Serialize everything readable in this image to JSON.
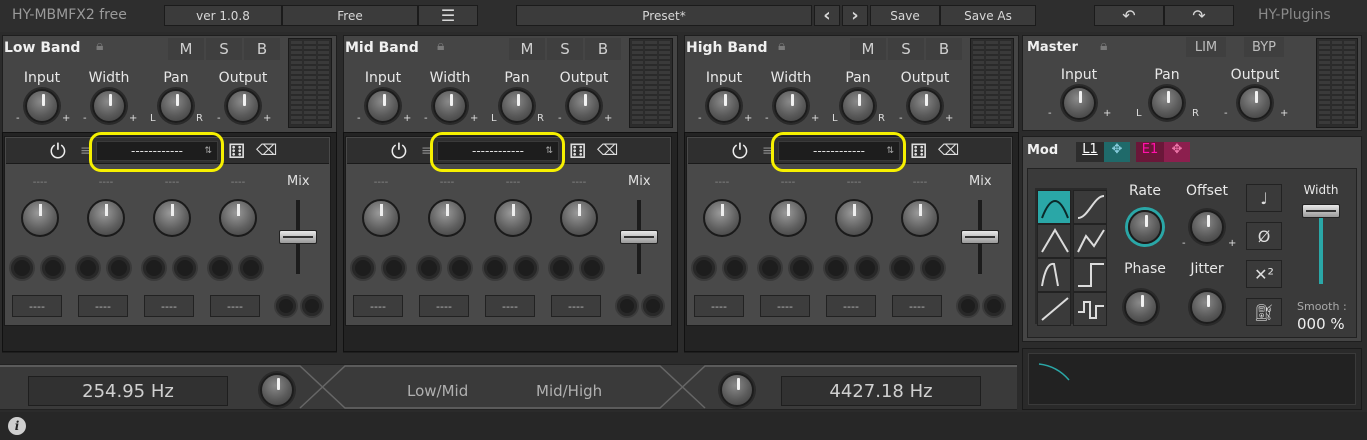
{
  "top": {
    "title": "HY-MBMFX2 free",
    "version": "ver 1.0.8",
    "license": "Free",
    "preset": "Preset*",
    "save": "Save",
    "save_as": "Save As",
    "brand": "HY-Plugins",
    "prev": "‹",
    "next": "›"
  },
  "bands": [
    {
      "title": "Low Band",
      "m": "M",
      "s": "S",
      "b": "B",
      "input": "Input",
      "width": "Width",
      "pan": "Pan",
      "output": "Output",
      "selector": "------------",
      "mix": "Mix",
      "dash": "----",
      "btn": "----"
    },
    {
      "title": "Mid Band",
      "m": "M",
      "s": "S",
      "b": "B",
      "input": "Input",
      "width": "Width",
      "pan": "Pan",
      "output": "Output",
      "selector": "------------",
      "mix": "Mix",
      "dash": "----",
      "btn": "----"
    },
    {
      "title": "High Band",
      "m": "M",
      "s": "S",
      "b": "B",
      "input": "Input",
      "width": "Width",
      "pan": "Pan",
      "output": "Output",
      "selector": "------------",
      "mix": "Mix",
      "dash": "----",
      "btn": "----"
    }
  ],
  "knob_marks": {
    "minus": "-",
    "plus": "+",
    "l": "L",
    "r": "R"
  },
  "master": {
    "title": "Master",
    "lim": "LIM",
    "byp": "BYP",
    "input": "Input",
    "pan": "Pan",
    "output": "Output"
  },
  "mod": {
    "title": "Mod",
    "l1": "L1",
    "e1": "E1",
    "rate": "Rate",
    "offset": "Offset",
    "phase": "Phase",
    "jitter": "Jitter",
    "width": "Width",
    "smooth_label": "Smooth :",
    "smooth_value": "000 %"
  },
  "crossover": {
    "low_freq": "254.95 Hz",
    "high_freq": "4427.18 Hz",
    "low_mid": "Low/Mid",
    "mid_high": "Mid/High"
  },
  "colors": {
    "highlight": "#f6f000",
    "l1": "#2aa7a7",
    "e1": "#b0255f"
  }
}
